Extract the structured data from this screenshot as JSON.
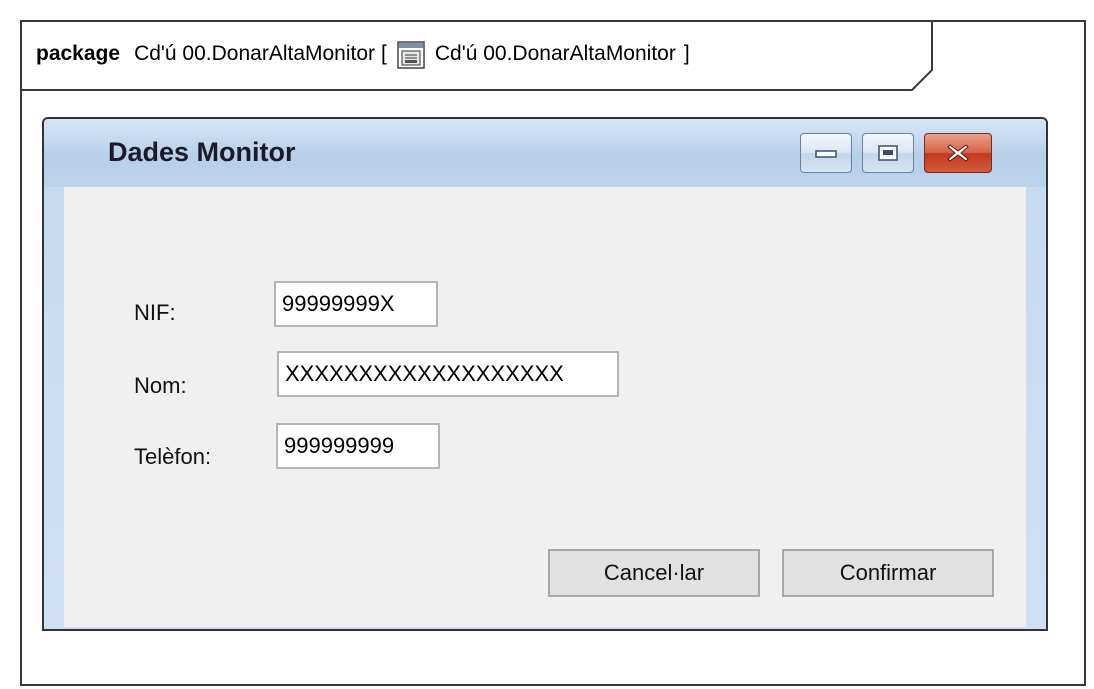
{
  "package_tab": {
    "keyword": "package",
    "name": "Cd'ú 00.DonarAltaMonitor",
    "open_bracket": "[",
    "diagram_ref": "Cd'ú 00.DonarAltaMonitor",
    "close_bracket": "]",
    "diagram_icon": "window-diagram-icon"
  },
  "dialog": {
    "title": "Dades Monitor",
    "window_buttons": {
      "minimize_icon": "minimize-icon",
      "maximize_icon": "maximize-icon",
      "close_icon": "close-icon"
    },
    "fields": [
      {
        "label": "NIF:",
        "value": "99999999X"
      },
      {
        "label": "Nom:",
        "value": "XXXXXXXXXXXXXXXXXXX"
      },
      {
        "label": "Telèfon:",
        "value": "999999999"
      }
    ],
    "buttons": {
      "cancel": "Cancel·lar",
      "confirm": "Confirmar"
    }
  },
  "colors": {
    "frame_border": "#3a3a3a",
    "titlebar": "#b7cfe9",
    "content_bg": "#f0f0f0",
    "close_button": "#c2391f"
  }
}
